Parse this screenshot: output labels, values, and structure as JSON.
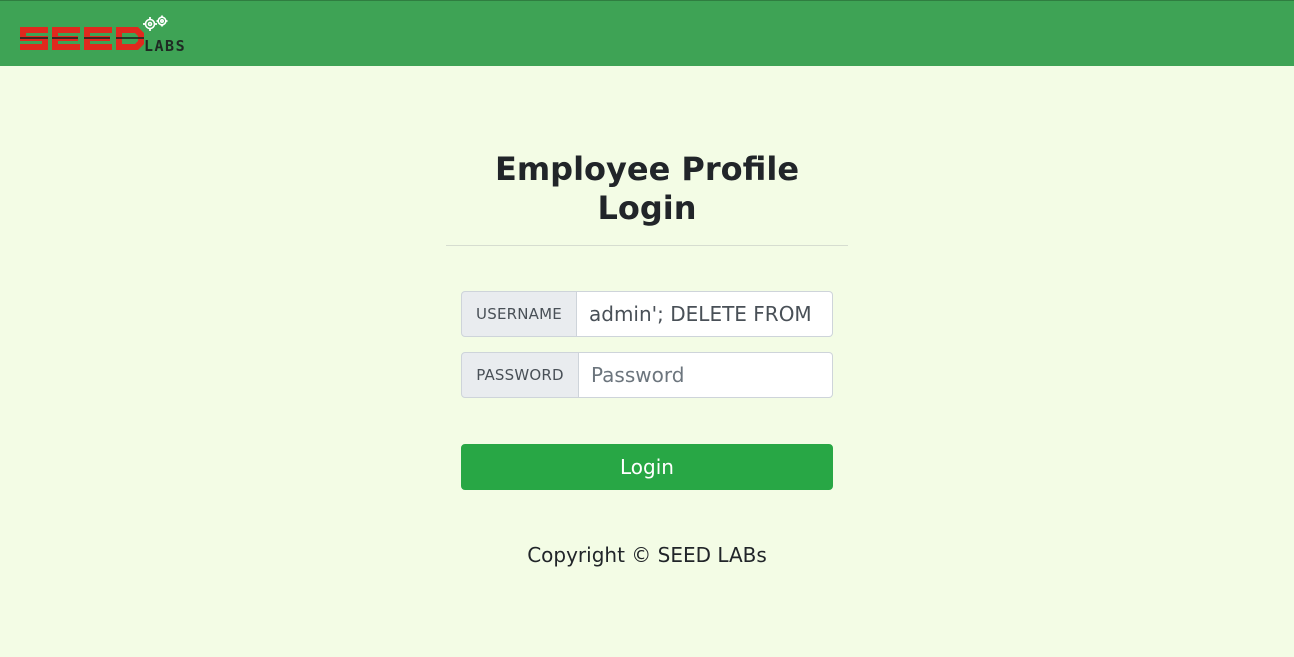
{
  "header": {
    "logo_text": "SEED LABS",
    "brand_color": "#3ea355"
  },
  "login": {
    "title": "Employee Profile Login",
    "username_label": "USERNAME",
    "username_value": "admin'; DELETE FROM",
    "password_label": "PASSWORD",
    "password_placeholder": "Password",
    "password_value": "",
    "login_button": "Login",
    "button_color": "#28a745"
  },
  "footer": {
    "copyright": "Copyright © SEED LABs"
  },
  "colors": {
    "background": "#f3fce5",
    "logo_red": "#e0291e",
    "logo_dark": "#1f2a23"
  }
}
